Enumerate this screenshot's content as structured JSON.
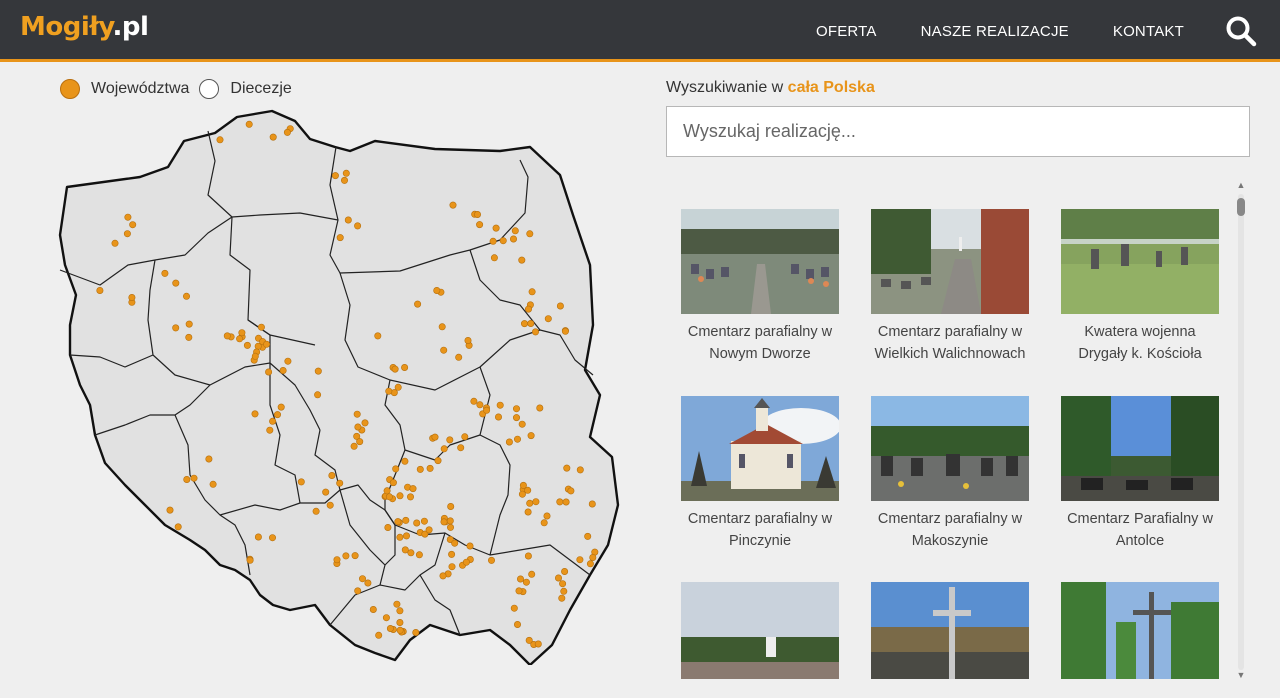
{
  "header": {
    "logo_brand": "Mogiły",
    "logo_tld": ".pl",
    "nav": [
      "OFERTA",
      "NASZE REALIZACJE",
      "KONTAKT"
    ],
    "search_icon": "search-icon"
  },
  "map": {
    "radio_options": [
      {
        "label": "Województwa",
        "selected": true
      },
      {
        "label": "Diecezje",
        "selected": false
      }
    ],
    "marker_color": "#e8941a",
    "region_fill": "#e1e1e1"
  },
  "search": {
    "label_prefix": "Wyszukiwanie w",
    "label_region": "cała Polska",
    "placeholder": "Wyszukaj realizację..."
  },
  "results": [
    {
      "title": "Cmentarz parafialny w Nowym Dworze"
    },
    {
      "title": "Cmentarz parafialny w Wielkich Walichnowach"
    },
    {
      "title": "Kwatera wojenna Drygały k. Kościoła"
    },
    {
      "title": "Cmentarz parafialny w Pinczynie"
    },
    {
      "title": "Cmentarz parafialny w Makoszynie"
    },
    {
      "title": "Cmentarz Parafialny w Antolce"
    },
    {
      "title": ""
    },
    {
      "title": ""
    },
    {
      "title": ""
    }
  ],
  "colors": {
    "accent": "#e8941a",
    "header_bg": "#35373b",
    "page_bg": "#efefef"
  }
}
